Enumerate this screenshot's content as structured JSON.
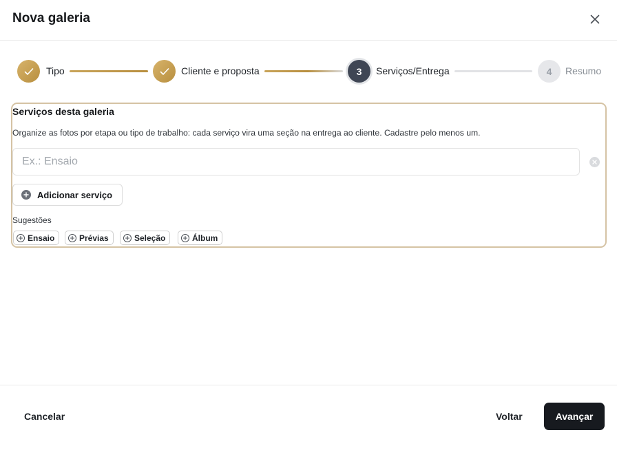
{
  "dialog": {
    "title": "Nova galeria"
  },
  "stepper": {
    "steps": [
      {
        "label": "Tipo",
        "status": "completed"
      },
      {
        "label": "Cliente e proposta",
        "status": "completed"
      },
      {
        "number": "3",
        "label": "Serviços/Entrega",
        "status": "current"
      },
      {
        "number": "4",
        "label": "Resumo",
        "status": "upcoming"
      }
    ]
  },
  "services": {
    "title": "Serviços desta galeria",
    "description": "Organize as fotos por etapa ou tipo de trabalho: cada serviço vira uma seção na entrega ao cliente. Cadastre pelo menos um.",
    "input_placeholder": "Ex.: Ensaio",
    "input_value": "",
    "add_button_label": "Adicionar serviço",
    "suggestions_label": "Sugestões",
    "suggestions": [
      "Ensaio",
      "Prévias",
      "Seleção",
      "Álbum"
    ]
  },
  "footer": {
    "cancel_label": "Cancelar",
    "back_label": "Voltar",
    "next_label": "Avançar"
  },
  "colors": {
    "gold_accent": "#c9a45a",
    "current_step": "#3f4654",
    "primary_button": "#171a1f",
    "section_border": "#d5c3a4"
  }
}
